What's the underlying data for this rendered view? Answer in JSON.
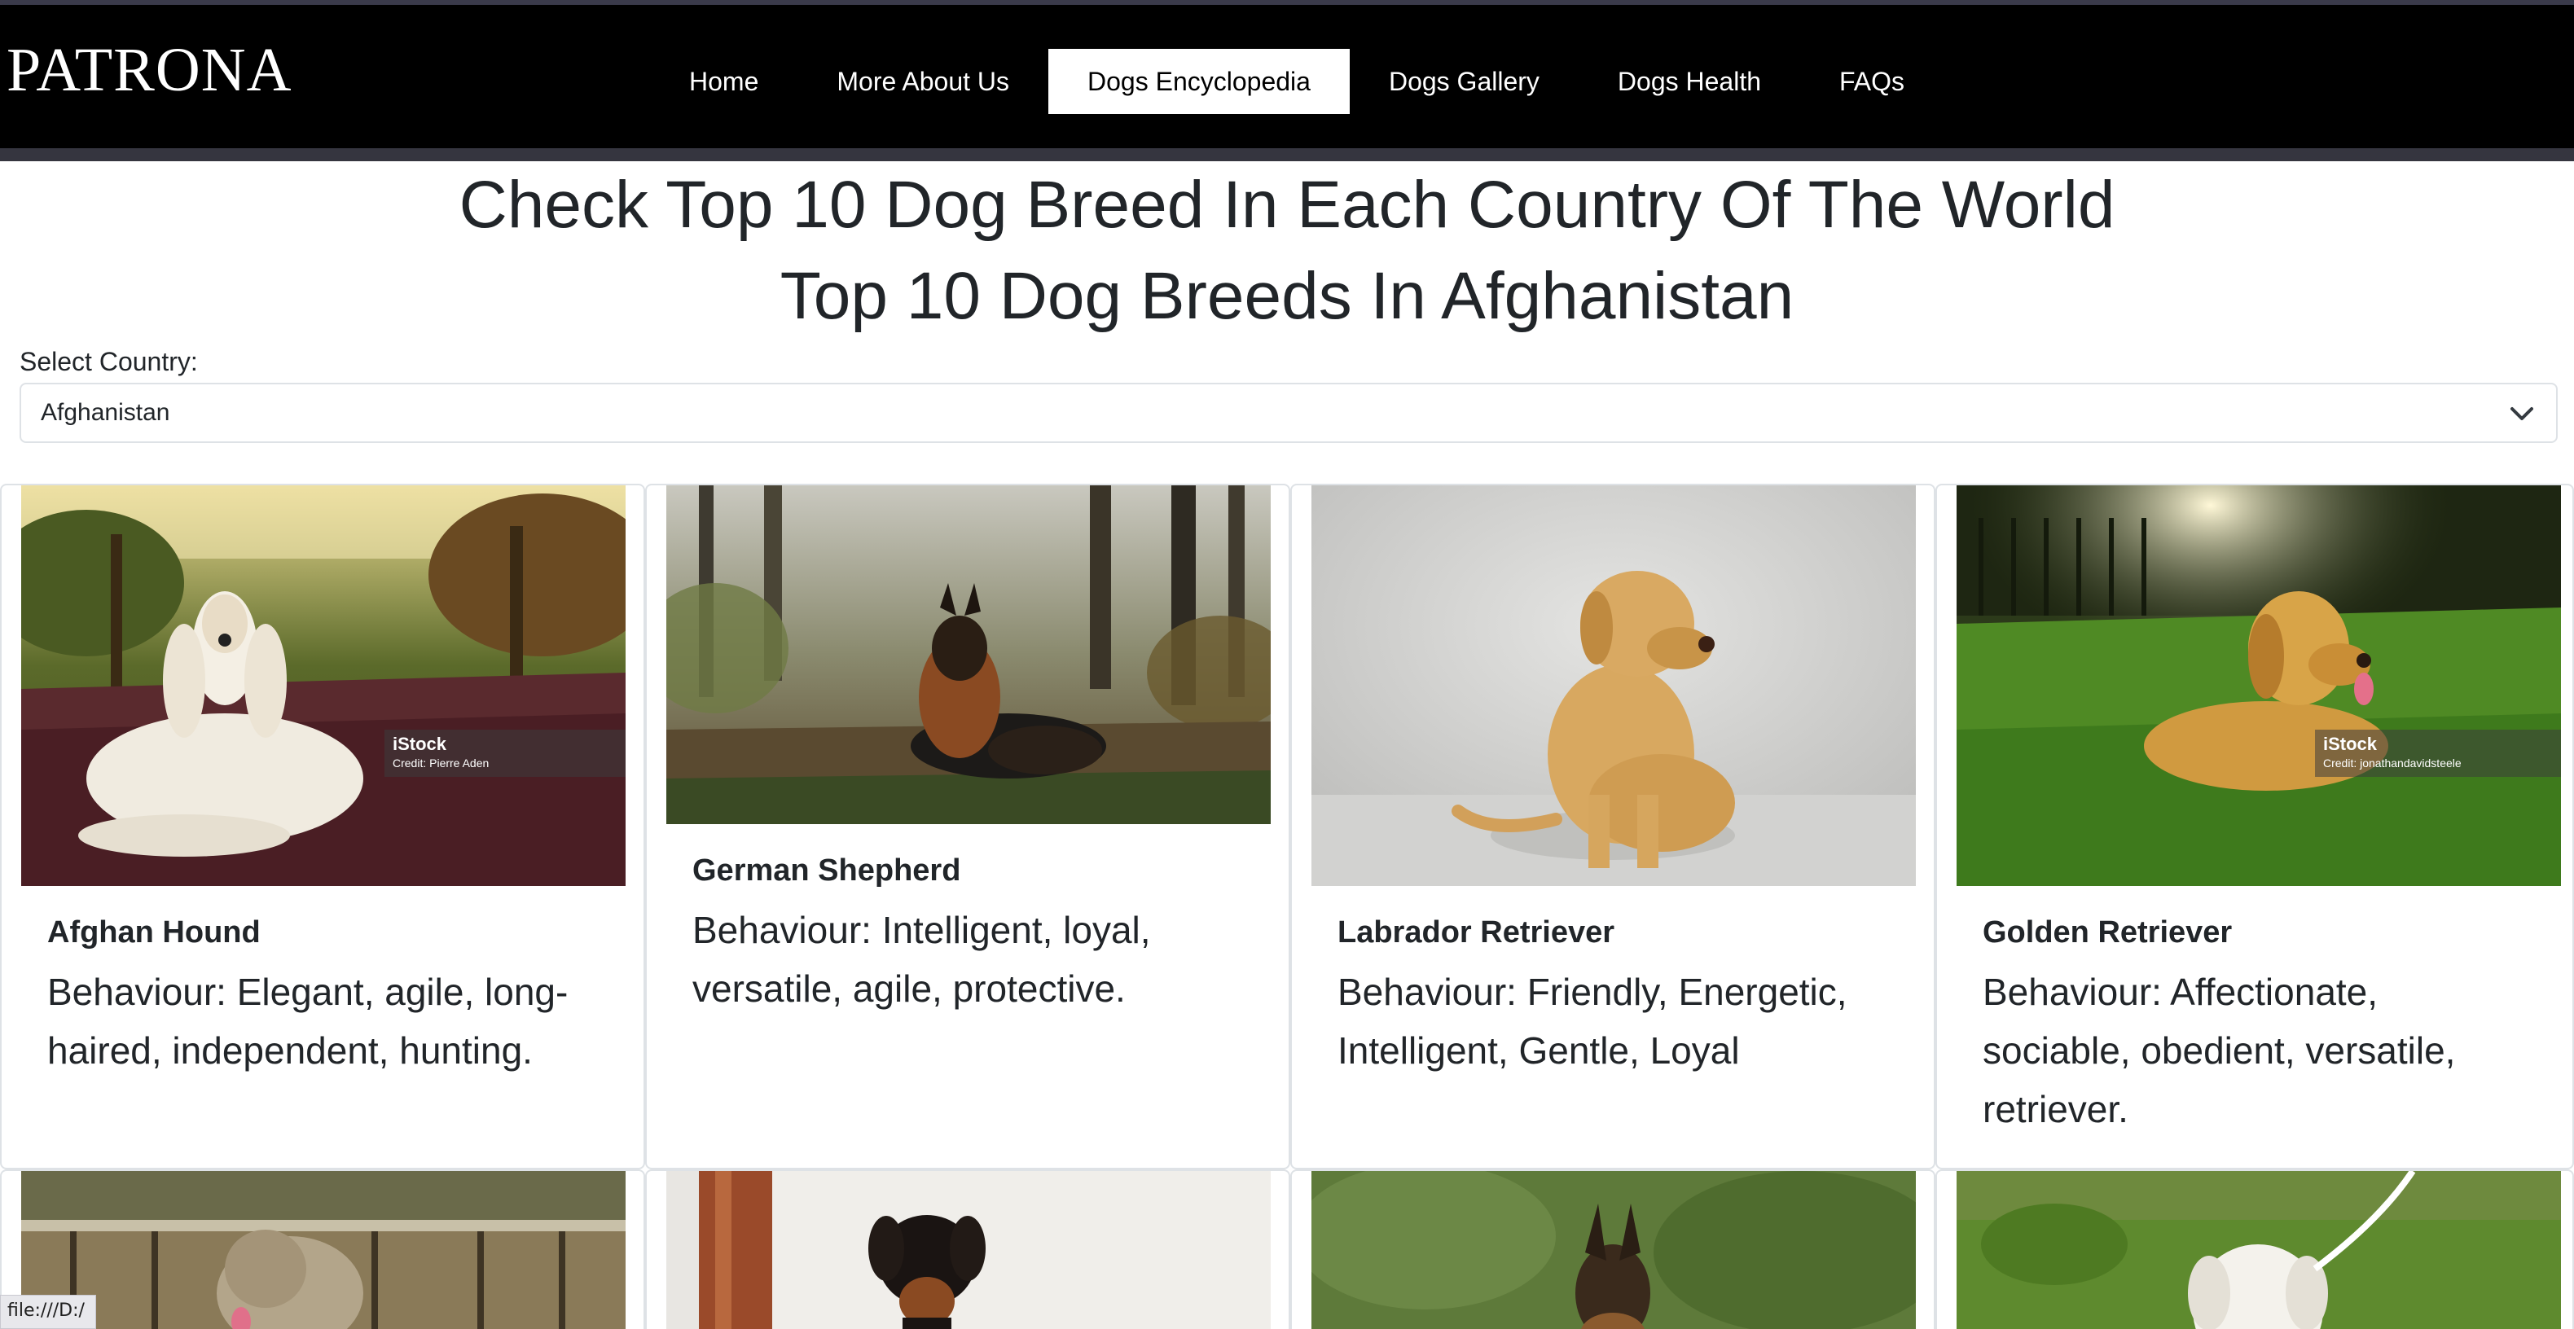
{
  "brand": "PATRONA",
  "nav": {
    "items": [
      {
        "label": "Home",
        "active": false
      },
      {
        "label": "More About Us",
        "active": false
      },
      {
        "label": "Dogs Encyclopedia",
        "active": true
      },
      {
        "label": "Dogs Gallery",
        "active": false
      },
      {
        "label": "Dogs Health",
        "active": false
      },
      {
        "label": "FAQs",
        "active": false
      }
    ]
  },
  "headings": {
    "main": "Check Top 10 Dog Breed In Each Country Of The World",
    "sub": "Top 10 Dog Breeds In Afghanistan"
  },
  "country_select": {
    "label": "Select Country:",
    "value": "Afghanistan",
    "icon": "chevron-down-icon"
  },
  "cards": [
    {
      "title": "Afghan Hound",
      "behaviour": "Behaviour: Elegant, agile, long-haired, independent, hunting.",
      "image": "afghan-hound-photo",
      "watermark": {
        "brand": "iStock",
        "credit": "Credit: Pierre Aden"
      }
    },
    {
      "title": "German Shepherd",
      "behaviour": "Behaviour: Intelligent, loyal, versatile, agile, protective.",
      "image": "german-shepherd-photo"
    },
    {
      "title": "Labrador Retriever",
      "behaviour": "Behaviour: Friendly, Energetic, Intelligent, Gentle, Loyal",
      "image": "labrador-retriever-photo"
    },
    {
      "title": "Golden Retriever",
      "behaviour": "Behaviour: Affectionate, sociable, obedient, versatile, retriever.",
      "image": "golden-retriever-photo",
      "watermark": {
        "brand": "iStock",
        "credit": "Credit: jonathandavidsteele"
      }
    }
  ],
  "row2_images": [
    "irish-wolfhound-photo",
    "doberman-photo",
    "belgian-malinois-photo",
    "white-dog-on-leash-photo"
  ],
  "status_bar": {
    "url": "file:///D:/"
  },
  "colors": {
    "navbar_bg": "#000000",
    "active_tab_bg": "#ffffff",
    "text": "#212529",
    "border": "#dee2e6"
  }
}
